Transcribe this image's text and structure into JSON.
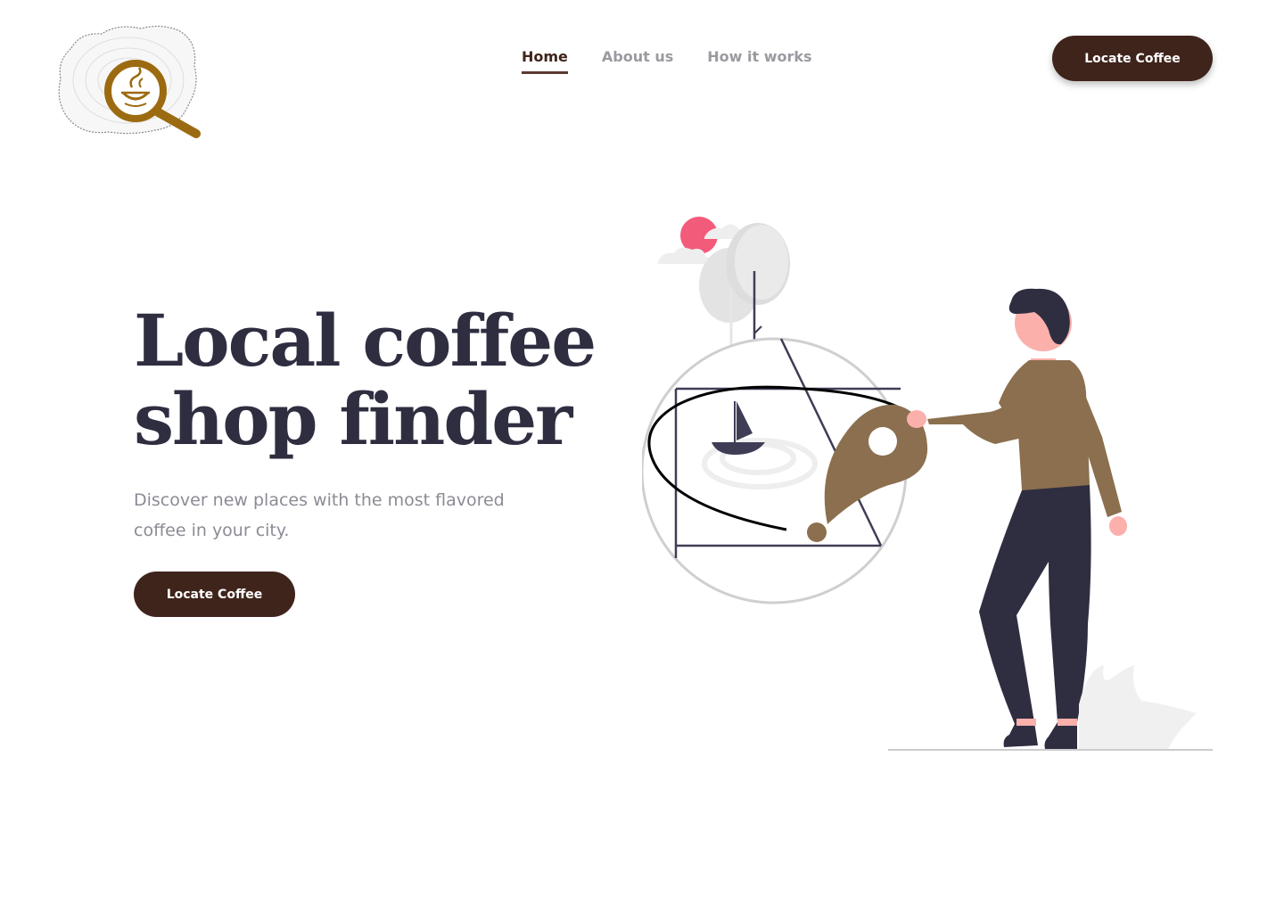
{
  "header": {
    "nav": [
      {
        "label": "Home"
      },
      {
        "label": "About us"
      },
      {
        "label": "How it works"
      }
    ],
    "cta_label": "Locate Coffee"
  },
  "hero": {
    "title": "Local coffee shop finder",
    "subtitle": "Discover new places with the most flavored coffee in your city.",
    "cta_label": "Locate Coffee"
  },
  "colors": {
    "brand_brown": "#3f241c",
    "text_dark": "#2f2e41",
    "accent_gold": "#9c6a10",
    "pin_brown": "#8b6f4e"
  },
  "icons": [
    "logo-magnifier-coffee-icon",
    "map-pin-icon",
    "sailboat-icon",
    "sun-icon"
  ]
}
